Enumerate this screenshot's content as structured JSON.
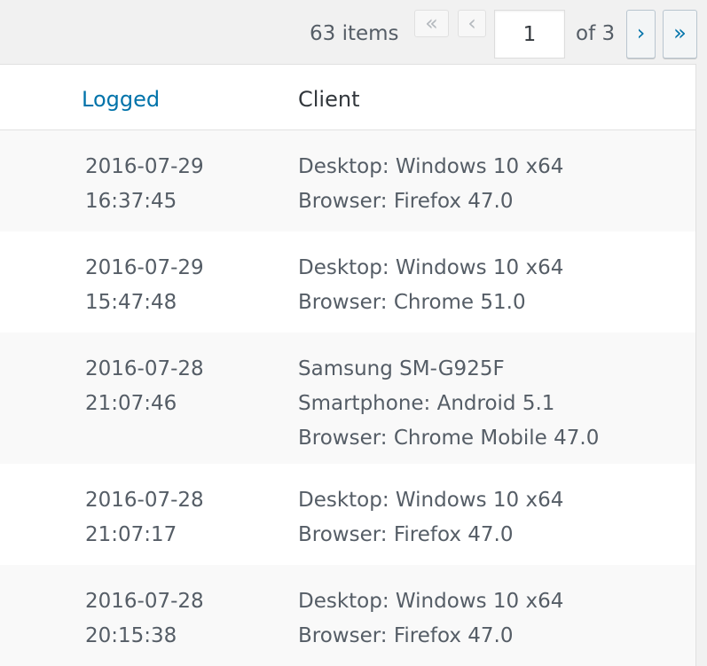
{
  "pagination": {
    "items_count": "63 items",
    "first_label": "«",
    "prev_label": "‹",
    "current_page": "1",
    "total_pages": "of 3",
    "next_label": "›",
    "last_label": "»"
  },
  "table": {
    "columns": {
      "logged": "Logged",
      "client": "Client"
    },
    "rows": [
      {
        "date": "2016-07-29",
        "time": "16:37:45",
        "client": [
          "Desktop: Windows 10 x64",
          "Browser: Firefox 47.0"
        ]
      },
      {
        "date": "2016-07-29",
        "time": "15:47:48",
        "client": [
          "Desktop: Windows 10 x64",
          "Browser: Chrome 51.0"
        ]
      },
      {
        "date": "2016-07-28",
        "time": "21:07:46",
        "client": [
          "Samsung SM-G925F",
          "Smartphone: Android 5.1",
          "Browser: Chrome Mobile 47.0"
        ]
      },
      {
        "date": "2016-07-28",
        "time": "21:07:17",
        "client": [
          "Desktop: Windows 10 x64",
          "Browser: Firefox 47.0"
        ]
      },
      {
        "date": "2016-07-28",
        "time": "20:15:38",
        "client": [
          "Desktop: Windows 10 x64",
          "Browser: Firefox 47.0"
        ]
      }
    ]
  },
  "colors": {
    "link": "#0073aa",
    "text": "#555d66",
    "heading": "#32373c",
    "row_alt": "#f9f9f9",
    "background": "#f1f1f1"
  }
}
